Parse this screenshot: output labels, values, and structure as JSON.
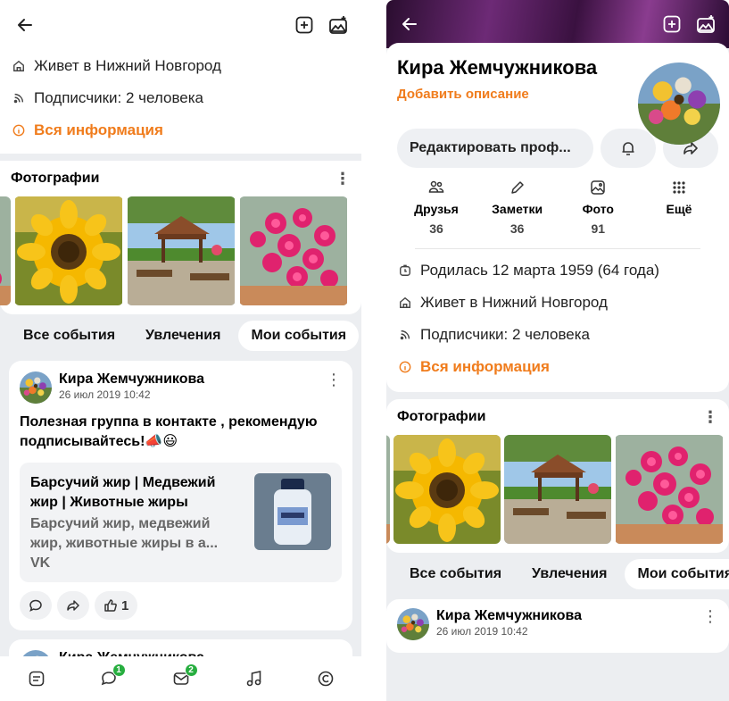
{
  "left": {
    "info": {
      "city": "Живет в Нижний Новгород",
      "followers": "Подписчики:  2 человека",
      "all_info": "Вся информация"
    },
    "photos_title": "Фотографии",
    "tabs": [
      "Все события",
      "Увлечения",
      "Мои события"
    ],
    "post": {
      "author": "Кира Жемчужникова",
      "date": "26 июл 2019 10:42",
      "text": "Полезная группа в контакте , рекомендую подписывайтесь!📣😃",
      "link_title": "Барсучий жир | Медвежий жир | Животные жиры",
      "link_desc": "Барсучий жир, медвежий жир, животные жиры в а...",
      "link_source": "VK",
      "likes": "1"
    },
    "next_post_author": "Кира Жемчужникова",
    "nav_badges": {
      "messages": "1",
      "notifications": "2"
    }
  },
  "right": {
    "name": "Кира Жемчужникова",
    "add_description": "Добавить описание",
    "edit_button": "Редактировать проф...",
    "stats": [
      {
        "label": "Друзья",
        "count": "36",
        "icon": "friends-icon"
      },
      {
        "label": "Заметки",
        "count": "36",
        "icon": "pencil-icon"
      },
      {
        "label": "Фото",
        "count": "91",
        "icon": "photo-icon"
      },
      {
        "label": "Ещё",
        "count": "",
        "icon": "grid-icon"
      }
    ],
    "info": {
      "birthday": "Родилась 12 марта 1959 (64 года)",
      "city": "Живет в Нижний Новгород",
      "followers": "Подписчики:  2 человека",
      "all_info": "Вся информация"
    },
    "photos_title": "Фотографии",
    "tabs": [
      "Все события",
      "Увлечения",
      "Мои события"
    ],
    "post": {
      "author": "Кира Жемчужникова",
      "date": "26 июл 2019 10:42"
    }
  },
  "colors": {
    "accent": "#f07c1c",
    "badge": "#27ae3f",
    "background": "#eceef1"
  }
}
